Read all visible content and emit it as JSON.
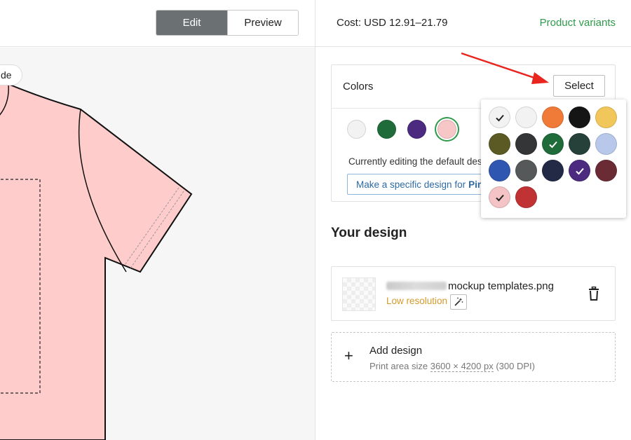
{
  "toolbar": {
    "edit_label": "Edit",
    "preview_label": "Preview"
  },
  "canvas": {
    "side_chip_label": "de",
    "shirt_color": "#ffcccc"
  },
  "header": {
    "cost": "Cost: USD 12.91–21.79",
    "variants_link": "Product variants"
  },
  "colors": {
    "title": "Colors",
    "select_label": "Select",
    "selected_swatches": [
      {
        "color": "#f2f2f2"
      },
      {
        "color": "#1f6b3a"
      },
      {
        "color": "#4b2a7f"
      },
      {
        "color": "#f7c6c7",
        "active": true
      }
    ],
    "note": "Currently editing the default des",
    "specific_prefix": "Make a specific design for",
    "specific_color": "Pink"
  },
  "palette": [
    {
      "color": "#f2f2f2",
      "checked": true
    },
    {
      "color": "#f2f2f2",
      "checked": false
    },
    {
      "color": "#f07a38",
      "checked": false
    },
    {
      "color": "#151515",
      "checked": false
    },
    {
      "color": "#f1c75b",
      "checked": false
    },
    {
      "color": "#5b5a24",
      "checked": false
    },
    {
      "color": "#333537",
      "checked": false
    },
    {
      "color": "#1f6b3a",
      "checked": true
    },
    {
      "color": "#26403a",
      "checked": false
    },
    {
      "color": "#b7c8ea",
      "checked": false
    },
    {
      "color": "#2f56b0",
      "checked": false
    },
    {
      "color": "#555959",
      "checked": false
    },
    {
      "color": "#222a45",
      "checked": false
    },
    {
      "color": "#4b2a7f",
      "checked": true
    },
    {
      "color": "#6b2b35",
      "checked": false
    },
    {
      "color": "#f3c3c5",
      "checked": true
    },
    {
      "color": "#c03233",
      "checked": false
    }
  ],
  "design": {
    "heading": "Your design",
    "file_name": "mockup templates.png",
    "low_res": "Low resolution",
    "add_title": "Add design",
    "add_prefix": "Print area size",
    "add_size": "3600 × 4200 px",
    "add_dpi": "(300 DPI)"
  },
  "accent_color": "#2e9a4a",
  "arrow_color": "#e8251f"
}
